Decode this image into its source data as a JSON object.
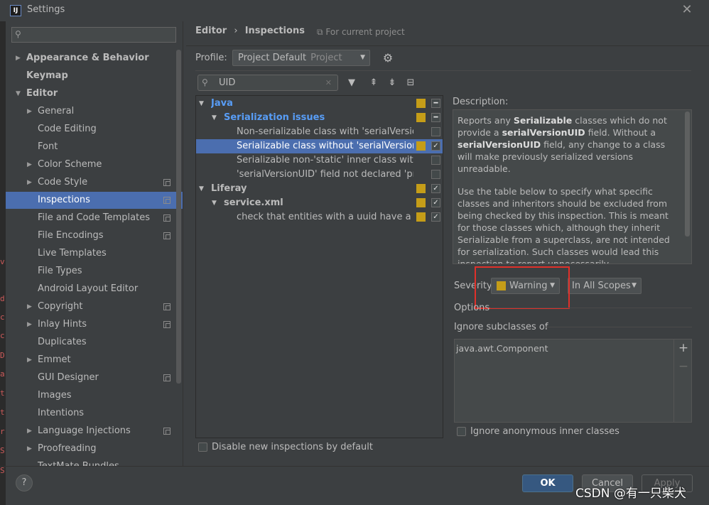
{
  "window": {
    "title": "Settings"
  },
  "behind_chars": [
    "v",
    "d",
    "c",
    "c",
    "D",
    "a",
    "t",
    "t",
    "r",
    "S",
    "S"
  ],
  "sidebar": {
    "search_placeholder": "",
    "items": [
      {
        "label": "Appearance & Behavior",
        "level": 0,
        "arrow": "right",
        "bold": true
      },
      {
        "label": "Keymap",
        "level": 0,
        "arrow": "",
        "bold": true
      },
      {
        "label": "Editor",
        "level": 0,
        "arrow": "down",
        "bold": true
      },
      {
        "label": "General",
        "level": 1,
        "arrow": "right"
      },
      {
        "label": "Code Editing",
        "level": 1,
        "arrow": ""
      },
      {
        "label": "Font",
        "level": 1,
        "arrow": ""
      },
      {
        "label": "Color Scheme",
        "level": 1,
        "arrow": "right"
      },
      {
        "label": "Code Style",
        "level": 1,
        "arrow": "right",
        "copy": true
      },
      {
        "label": "Inspections",
        "level": 1,
        "arrow": "",
        "copy": true,
        "selected": true
      },
      {
        "label": "File and Code Templates",
        "level": 1,
        "arrow": "",
        "copy": true
      },
      {
        "label": "File Encodings",
        "level": 1,
        "arrow": "",
        "copy": true
      },
      {
        "label": "Live Templates",
        "level": 1,
        "arrow": ""
      },
      {
        "label": "File Types",
        "level": 1,
        "arrow": ""
      },
      {
        "label": "Android Layout Editor",
        "level": 1,
        "arrow": ""
      },
      {
        "label": "Copyright",
        "level": 1,
        "arrow": "right",
        "copy": true
      },
      {
        "label": "Inlay Hints",
        "level": 1,
        "arrow": "right",
        "copy": true
      },
      {
        "label": "Duplicates",
        "level": 1,
        "arrow": ""
      },
      {
        "label": "Emmet",
        "level": 1,
        "arrow": "right"
      },
      {
        "label": "GUI Designer",
        "level": 1,
        "arrow": "",
        "copy": true
      },
      {
        "label": "Images",
        "level": 1,
        "arrow": ""
      },
      {
        "label": "Intentions",
        "level": 1,
        "arrow": ""
      },
      {
        "label": "Language Injections",
        "level": 1,
        "arrow": "right",
        "copy": true
      },
      {
        "label": "Proofreading",
        "level": 1,
        "arrow": "right"
      },
      {
        "label": "TextMate Bundles",
        "level": 1,
        "arrow": ""
      }
    ]
  },
  "breadcrumb": {
    "part1": "Editor",
    "sep": "›",
    "part2": "Inspections",
    "for_project": "For current project"
  },
  "profile": {
    "label": "Profile:",
    "value": "Project Default",
    "scope": "Project"
  },
  "filter": {
    "value": "UID"
  },
  "inspections": [
    {
      "label": "Java",
      "level": 0,
      "arrow": "down",
      "style": "blue",
      "sev": true,
      "check": "minus"
    },
    {
      "label": "Serialization issues",
      "level": 1,
      "arrow": "down",
      "style": "blue",
      "sev": true,
      "check": "minus"
    },
    {
      "label": "Non-serializable class with 'serialVersionUID'",
      "level": 2,
      "arrow": "",
      "style": "",
      "sev": false,
      "check": "off"
    },
    {
      "label": "Serializable class without 'serialVersionUID'",
      "level": 2,
      "arrow": "",
      "style": "",
      "sev": true,
      "check": "on",
      "selected": true
    },
    {
      "label": "Serializable non-'static' inner class without",
      "level": 2,
      "arrow": "",
      "style": "",
      "sev": false,
      "check": "off"
    },
    {
      "label": "'serialVersionUID' field not declared 'private'",
      "level": 2,
      "arrow": "",
      "style": "",
      "sev": false,
      "check": "off"
    },
    {
      "label": "Liferay",
      "level": 0,
      "arrow": "down",
      "style": "bold",
      "sev": true,
      "check": "on"
    },
    {
      "label": "service.xml",
      "level": 1,
      "arrow": "down",
      "style": "bold",
      "sev": true,
      "check": "on"
    },
    {
      "label": "check that entities with a uuid have a primary",
      "level": 2,
      "arrow": "",
      "style": "",
      "sev": true,
      "check": "on"
    }
  ],
  "description": {
    "label": "Description:",
    "p1_a": "Reports any ",
    "p1_b": "Serializable",
    "p1_c": " classes which do not provide a ",
    "p1_d": "serialVersionUID",
    "p1_e": " field. Without a ",
    "p1_f": "serialVersionUID",
    "p1_g": " field, any change to a class will make previously serialized versions unreadable.",
    "p2": "Use the table below to specify what specific classes and inheritors should be excluded from being checked by this inspection. This is meant for those classes which, although they inherit Serializable from a superclass, are not intended for serialization. Such classes would lead this inspection to report unnecessarily."
  },
  "severity": {
    "label": "Severity:",
    "value": "Warning",
    "color": "#c59d18",
    "scope": "In All Scopes"
  },
  "options": {
    "label": "Options",
    "ignore_label": "Ignore subclasses of",
    "ignore_items": [
      "java.awt.Component"
    ],
    "anon_label": "Ignore anonymous inner classes"
  },
  "disable_label": "Disable new inspections by default",
  "buttons": {
    "help": "?",
    "ok": "OK",
    "cancel": "Cancel",
    "apply": "Apply"
  },
  "watermark": "CSDN @有一只柴犬"
}
